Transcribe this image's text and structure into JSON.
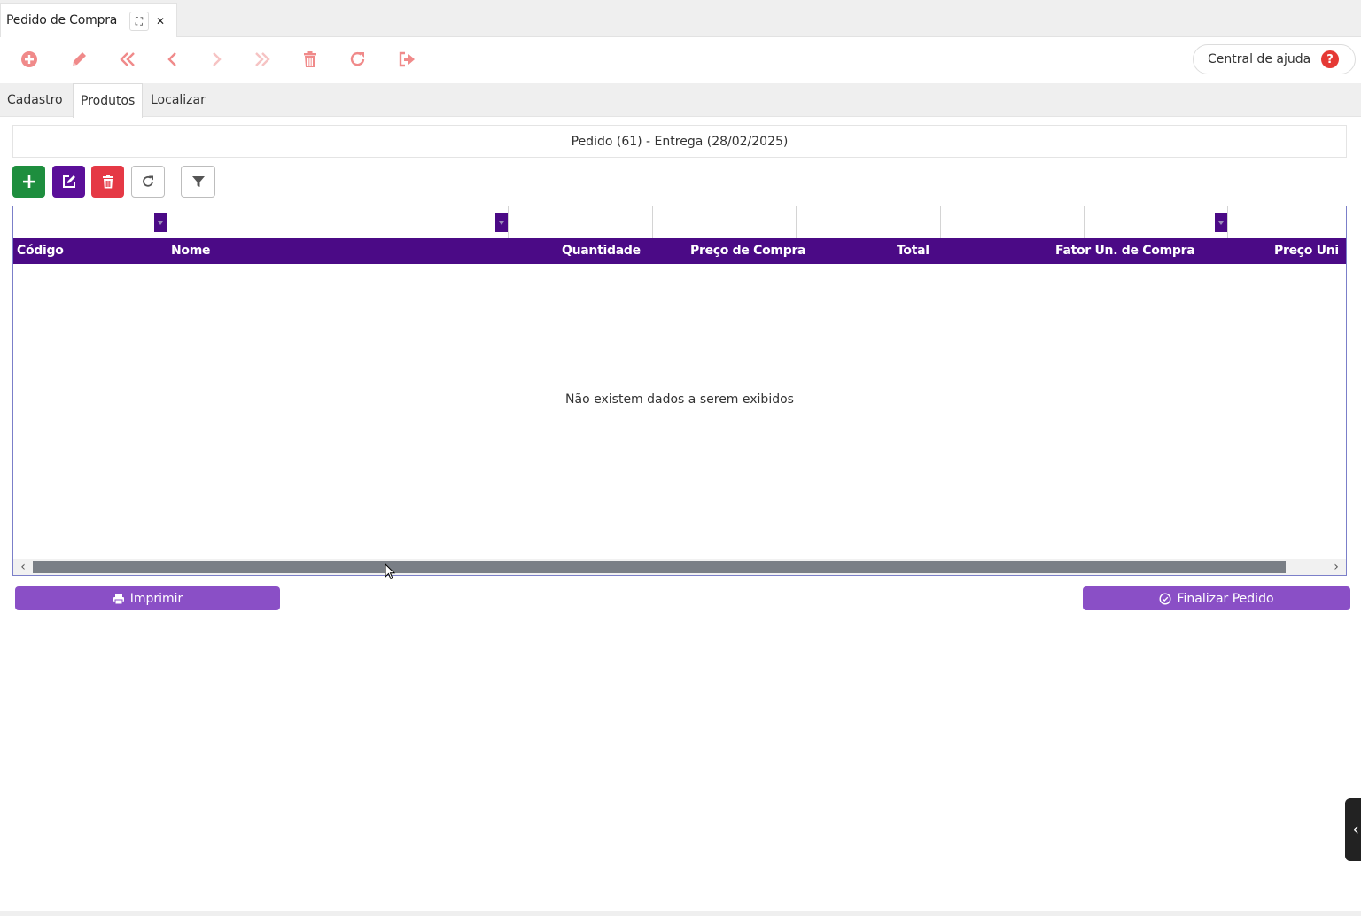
{
  "window": {
    "tab_title": "Pedido de Compra",
    "maximize_glyph": "⛶",
    "close_glyph": "✕"
  },
  "toolbar": {
    "icon_color": "#f08a8a",
    "tools": [
      "add-circle-icon",
      "pencil-icon",
      "first-record-icon",
      "previous-record-icon",
      "next-record-icon",
      "last-record-icon",
      "trash-icon",
      "refresh-icon",
      "exit-icon"
    ],
    "help_label": "Central de ajuda",
    "help_glyph": "?"
  },
  "subtabs": {
    "cadastro": "Cadastro",
    "produtos": "Produtos",
    "localizar": "Localizar",
    "active": "Produtos"
  },
  "order": {
    "info": "Pedido (61) - Entrega (28/02/2025)"
  },
  "grid": {
    "columns": [
      "Código",
      "Nome",
      "Quantidade",
      "Preço de Compra",
      "Total",
      "Fator Un. de Compra",
      "Preço Uni"
    ],
    "rows": [],
    "empty_message": "Não existem dados a serem exibidos",
    "header_color": "#4b0a86"
  },
  "actions": {
    "add_color": "#1e8e3e",
    "edit_color": "#5b0f99",
    "delete_color": "#e53945",
    "print_label": "Imprimir",
    "finish_label": "Finalizar Pedido"
  }
}
